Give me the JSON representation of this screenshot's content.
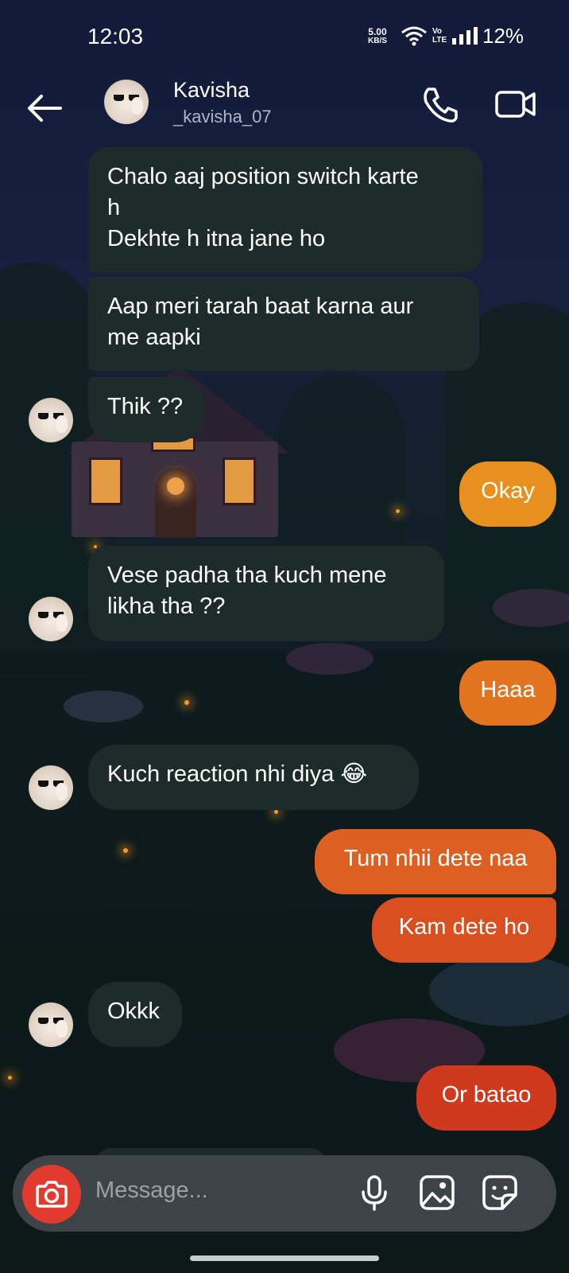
{
  "status_bar": {
    "time": "12:03",
    "net_speed_value": "5.00",
    "net_speed_unit": "KB/S",
    "network_tag_top": "Vo",
    "network_tag_bottom": "LTE",
    "battery": "12%"
  },
  "header": {
    "name": "Kavisha",
    "username": "_kavisha_07"
  },
  "messages": [
    {
      "side": "in",
      "text": "Chalo aaj position switch karte\nh\nDekhte h itna jane ho",
      "avatar": false
    },
    {
      "side": "in",
      "text": "Aap meri tarah baat karna aur\nme aapki",
      "avatar": false
    },
    {
      "side": "in",
      "text": "Thik ??",
      "avatar": true
    },
    {
      "side": "out",
      "text": "Okay",
      "color": "#e8901f"
    },
    {
      "side": "in",
      "text": "Vese padha tha kuch mene\nlikha tha ??",
      "avatar": true
    },
    {
      "side": "out",
      "text": "Haaa",
      "color": "#e2741f"
    },
    {
      "side": "in",
      "text": "Kuch reaction nhi diya 😂",
      "avatar": true
    },
    {
      "side": "out",
      "text": "Tum nhii dete naa",
      "color": "#dd5f22"
    },
    {
      "side": "out",
      "text": "Kam dete ho",
      "color": "#d94f1f"
    },
    {
      "side": "in",
      "text": "Okkk",
      "avatar": true
    },
    {
      "side": "out",
      "text": "Or batao",
      "color": "#cf3a1e"
    }
  ],
  "composer": {
    "placeholder": "Message..."
  },
  "icons": [
    "back-arrow-icon",
    "phone-icon",
    "video-camera-icon",
    "camera-icon",
    "microphone-icon",
    "gallery-icon",
    "sticker-icon",
    "wifi-icon",
    "signal-icon"
  ]
}
